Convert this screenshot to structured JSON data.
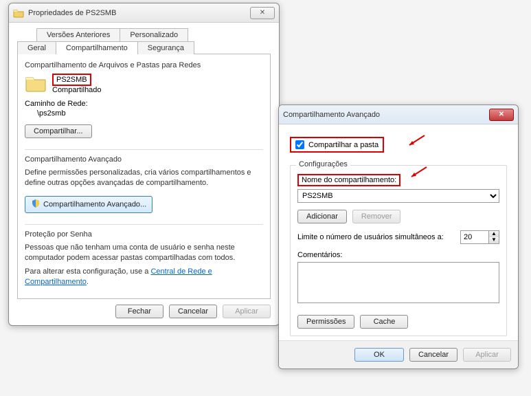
{
  "prop": {
    "title": "Propriedades de PS2SMB",
    "tabs_top": [
      "Versões Anteriores",
      "Personalizado"
    ],
    "tabs_bottom": [
      "Geral",
      "Compartilhamento",
      "Segurança"
    ],
    "network_sharing": {
      "heading": "Compartilhamento de Arquivos e Pastas para Redes",
      "name": "PS2SMB",
      "status": "Compartilhado",
      "path_label": "Caminho de Rede:",
      "path_value": "\\ps2smb",
      "share_btn": "Compartilhar..."
    },
    "advanced": {
      "heading": "Compartilhamento Avançado",
      "desc": "Define permissões personalizadas, cria vários compartilhamentos e define outras opções avançadas de compartilhamento.",
      "btn": "Compartilhamento Avançado..."
    },
    "password": {
      "heading": "Proteção por Senha",
      "desc1": "Pessoas que não tenham uma conta de usuário e senha neste computador podem acessar pastas compartilhadas com todos.",
      "desc2_prefix": "Para alterar esta configuração, use a ",
      "link": "Central de Rede e Compartilhamento",
      "desc2_suffix": "."
    },
    "buttons": {
      "close": "Fechar",
      "cancel": "Cancelar",
      "apply": "Aplicar"
    }
  },
  "adv": {
    "title": "Compartilhamento Avançado",
    "share_folder": "Compartilhar a pasta",
    "share_checked": true,
    "settings_label": "Configurações",
    "share_name_label": "Nome do compartilhamento:",
    "share_name_value": "PS2SMB",
    "add": "Adicionar",
    "remove": "Remover",
    "limit_label": "Limite o número de usuários simultâneos a:",
    "limit_value": "20",
    "comments_label": "Comentários:",
    "comments_value": "",
    "permissions": "Permissões",
    "cache": "Cache",
    "ok": "OK",
    "cancel": "Cancelar",
    "apply": "Aplicar"
  }
}
